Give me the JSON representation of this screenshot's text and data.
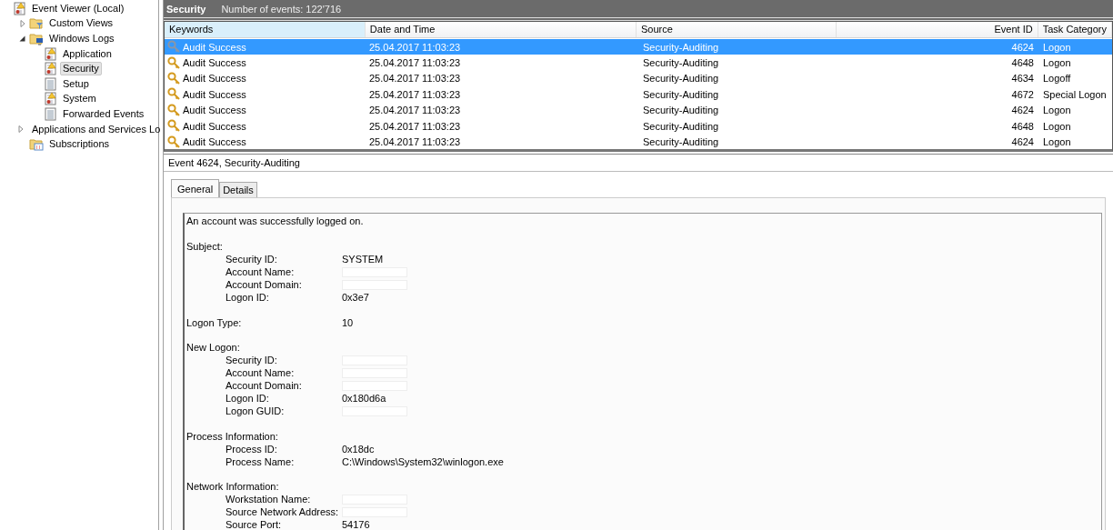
{
  "tree": [
    {
      "label": "Event Viewer (Local)",
      "kind": "viewer",
      "selected": false,
      "children": [
        {
          "label": "Custom Views",
          "kind": "filter",
          "expanded": false,
          "selected": false
        },
        {
          "label": "Windows Logs",
          "kind": "monitor",
          "expanded": true,
          "selected": false,
          "children": [
            {
              "label": "Application",
              "kind": "warning",
              "selected": false
            },
            {
              "label": "Security",
              "kind": "warning",
              "selected": true
            },
            {
              "label": "Setup",
              "kind": "log",
              "selected": false
            },
            {
              "label": "System",
              "kind": "warning",
              "selected": false
            },
            {
              "label": "Forwarded Events",
              "kind": "log",
              "selected": false
            }
          ]
        },
        {
          "label": "Applications and Services Lo",
          "kind": "folder",
          "expanded": false,
          "selected": false
        },
        {
          "label": "Subscriptions",
          "kind": "subscriptions",
          "selected": false
        }
      ]
    }
  ],
  "header": {
    "title": "Security",
    "count": "Number of events: 122'716"
  },
  "table": {
    "columns": [
      {
        "label": "Keywords",
        "selected": true
      },
      {
        "label": "Date and Time",
        "selected": false
      },
      {
        "label": "Source",
        "selected": false
      },
      {
        "label": "Event ID",
        "selected": false
      },
      {
        "label": "Task Category",
        "selected": false
      }
    ],
    "rows": [
      {
        "keywords": "Audit Success",
        "date": "25.04.2017 11:03:23",
        "source": "Security-Auditing",
        "event_id": "4624",
        "category": "Logon",
        "selected": true
      },
      {
        "keywords": "Audit Success",
        "date": "25.04.2017 11:03:23",
        "source": "Security-Auditing",
        "event_id": "4648",
        "category": "Logon",
        "selected": false
      },
      {
        "keywords": "Audit Success",
        "date": "25.04.2017 11:03:23",
        "source": "Security-Auditing",
        "event_id": "4634",
        "category": "Logoff",
        "selected": false
      },
      {
        "keywords": "Audit Success",
        "date": "25.04.2017 11:03:23",
        "source": "Security-Auditing",
        "event_id": "4672",
        "category": "Special Logon",
        "selected": false
      },
      {
        "keywords": "Audit Success",
        "date": "25.04.2017 11:03:23",
        "source": "Security-Auditing",
        "event_id": "4624",
        "category": "Logon",
        "selected": false
      },
      {
        "keywords": "Audit Success",
        "date": "25.04.2017 11:03:23",
        "source": "Security-Auditing",
        "event_id": "4648",
        "category": "Logon",
        "selected": false
      },
      {
        "keywords": "Audit Success",
        "date": "25.04.2017 11:03:23",
        "source": "Security-Auditing",
        "event_id": "4624",
        "category": "Logon",
        "selected": false
      }
    ]
  },
  "detail": {
    "title": "Event 4624, Security-Auditing",
    "tabs": [
      {
        "label": "General",
        "selected": true
      },
      {
        "label": "Details",
        "selected": false
      }
    ],
    "message": "An account was successfully logged on.",
    "sections": [
      {
        "heading": "Subject:",
        "fields": [
          {
            "label": "Security ID:",
            "value": "SYSTEM",
            "redacted": false
          },
          {
            "label": "Account Name:",
            "redacted": true
          },
          {
            "label": "Account Domain:",
            "redacted": true
          },
          {
            "label": "Logon ID:",
            "value": "0x3e7",
            "redacted": false
          }
        ]
      },
      {
        "heading": "Logon Type:",
        "value": "10"
      },
      {
        "heading": "New Logon:",
        "fields": [
          {
            "label": "Security ID:",
            "redacted": true
          },
          {
            "label": "Account Name:",
            "redacted": true
          },
          {
            "label": "Account Domain:",
            "redacted": true
          },
          {
            "label": "Logon ID:",
            "value": "0x180d6a",
            "redacted": false
          },
          {
            "label": "Logon GUID:",
            "redacted": true
          }
        ]
      },
      {
        "heading": "Process Information:",
        "fields": [
          {
            "label": "Process ID:",
            "value": "0x18dc",
            "redacted": false
          },
          {
            "label": "Process Name:",
            "value": "C:\\Windows\\System32\\winlogon.exe",
            "redacted": false
          }
        ]
      },
      {
        "heading": "Network Information:",
        "fields": [
          {
            "label": "Workstation Name:",
            "redacted": true
          },
          {
            "label": "Source Network Address:",
            "redacted": true
          },
          {
            "label": "Source Port:",
            "value": "54176",
            "redacted": false
          }
        ]
      }
    ]
  }
}
